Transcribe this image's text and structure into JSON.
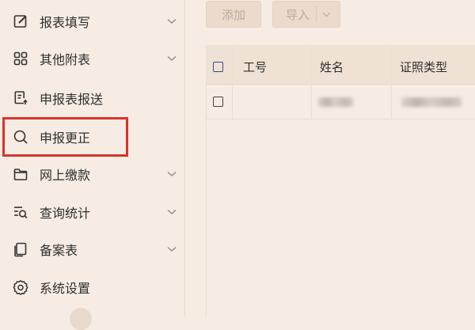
{
  "sidebar": {
    "items": [
      {
        "label": "报表填写",
        "icon": "edit-icon",
        "has_chevron": true
      },
      {
        "label": "其他附表",
        "icon": "grid-icon",
        "has_chevron": true
      },
      {
        "label": "申报表报送",
        "icon": "document-upload-icon",
        "has_chevron": false
      },
      {
        "label": "申报更正",
        "icon": "search-icon",
        "has_chevron": false
      },
      {
        "label": "网上缴款",
        "icon": "folder-icon",
        "has_chevron": true
      },
      {
        "label": "查询统计",
        "icon": "list-search-icon",
        "has_chevron": true
      },
      {
        "label": "备案表",
        "icon": "copy-icon",
        "has_chevron": true
      },
      {
        "label": "系统设置",
        "icon": "gear-icon",
        "has_chevron": false
      }
    ],
    "highlighted_item": "申报更正"
  },
  "toolbar": {
    "add_label": "添加",
    "import_label": "导入"
  },
  "table": {
    "columns": [
      "工号",
      "姓名",
      "证照类型"
    ],
    "rows": [
      {
        "employee_id": "",
        "name": "(blurred)",
        "id_type": "(blurred)"
      }
    ]
  },
  "colors": {
    "background": "#f6ece3",
    "highlight_border": "#d6342c",
    "disabled_button": "#ecdbcc",
    "header_checkbox": "#2f4f8f"
  }
}
